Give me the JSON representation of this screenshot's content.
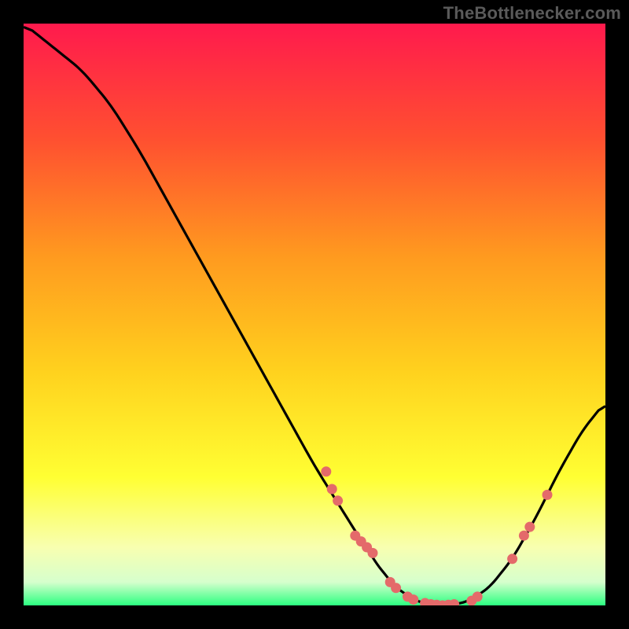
{
  "attribution": "TheBottlenecker.com",
  "chart_data": {
    "type": "line",
    "title": "",
    "xlabel": "",
    "ylabel": "",
    "xlim": [
      0,
      100
    ],
    "ylim": [
      0,
      100
    ],
    "gradient_stops": [
      {
        "offset": 0,
        "color": "#ff1a4d"
      },
      {
        "offset": 20,
        "color": "#ff5030"
      },
      {
        "offset": 40,
        "color": "#ff9a1f"
      },
      {
        "offset": 60,
        "color": "#ffd21e"
      },
      {
        "offset": 78,
        "color": "#ffff33"
      },
      {
        "offset": 90,
        "color": "#f8ffb0"
      },
      {
        "offset": 96,
        "color": "#d6ffcd"
      },
      {
        "offset": 100,
        "color": "#2bff80"
      }
    ],
    "curve": [
      {
        "x": 0,
        "y": 100
      },
      {
        "x": 5,
        "y": 96
      },
      {
        "x": 10,
        "y": 92
      },
      {
        "x": 15,
        "y": 86
      },
      {
        "x": 20,
        "y": 78
      },
      {
        "x": 25,
        "y": 69
      },
      {
        "x": 30,
        "y": 60
      },
      {
        "x": 35,
        "y": 51
      },
      {
        "x": 40,
        "y": 42
      },
      {
        "x": 45,
        "y": 33
      },
      {
        "x": 50,
        "y": 24
      },
      {
        "x": 55,
        "y": 16
      },
      {
        "x": 60,
        "y": 8
      },
      {
        "x": 64,
        "y": 3
      },
      {
        "x": 68,
        "y": 0.5
      },
      {
        "x": 72,
        "y": 0
      },
      {
        "x": 76,
        "y": 0.5
      },
      {
        "x": 80,
        "y": 3
      },
      {
        "x": 84,
        "y": 8
      },
      {
        "x": 88,
        "y": 15
      },
      {
        "x": 92,
        "y": 23
      },
      {
        "x": 96,
        "y": 30
      },
      {
        "x": 100,
        "y": 35
      }
    ],
    "markers": [
      {
        "x": 52,
        "y": 23
      },
      {
        "x": 53,
        "y": 20
      },
      {
        "x": 54,
        "y": 18
      },
      {
        "x": 57,
        "y": 12
      },
      {
        "x": 58,
        "y": 11
      },
      {
        "x": 59,
        "y": 10
      },
      {
        "x": 60,
        "y": 9
      },
      {
        "x": 63,
        "y": 4
      },
      {
        "x": 64,
        "y": 3
      },
      {
        "x": 66,
        "y": 1.5
      },
      {
        "x": 67,
        "y": 1
      },
      {
        "x": 69,
        "y": 0.4
      },
      {
        "x": 70,
        "y": 0.2
      },
      {
        "x": 71,
        "y": 0.1
      },
      {
        "x": 72,
        "y": 0
      },
      {
        "x": 73,
        "y": 0.1
      },
      {
        "x": 74,
        "y": 0.2
      },
      {
        "x": 77,
        "y": 0.8
      },
      {
        "x": 78,
        "y": 1.5
      },
      {
        "x": 84,
        "y": 8
      },
      {
        "x": 86,
        "y": 12
      },
      {
        "x": 87,
        "y": 13.5
      },
      {
        "x": 90,
        "y": 19
      }
    ]
  }
}
